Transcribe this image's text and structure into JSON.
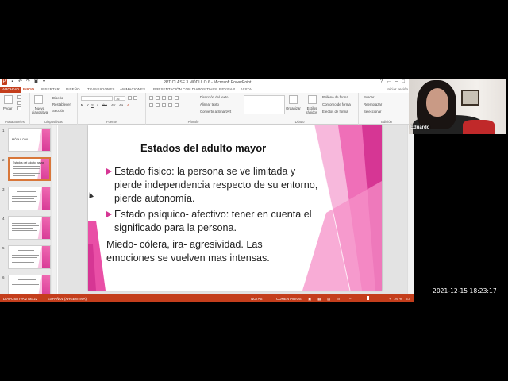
{
  "window": {
    "title": "PPT CLASE 3 MÓDULO 6 - Microsoft PowerPoint",
    "signin": "Iniciar sesión"
  },
  "ribbon_tabs": [
    "INICIO",
    "INSERTAR",
    "DISEÑO",
    "TRANSICIONES",
    "ANIMACIONES",
    "PRESENTACIÓN CON DIAPOSITIVAS",
    "REVISAR",
    "VISTA"
  ],
  "file_tab": "ARCHIVO",
  "ribbon": {
    "portapapeles": {
      "label": "Portapapeles",
      "pegar": "Pegar"
    },
    "diapositivas": {
      "label": "Diapositivas",
      "nueva": "Nueva diapositiva",
      "diseno": "Diseño",
      "restablecer": "Restablecer",
      "seccion": "Sección"
    },
    "fuente": {
      "label": "Fuente",
      "size": "16"
    },
    "parrafo": {
      "label": "Párrafo",
      "direccion": "Dirección del texto",
      "alinear": "Alinear texto",
      "smartart": "Convertir a SmartArt"
    },
    "dibujo": {
      "label": "Dibujo",
      "organizar": "Organizar",
      "estilos": "Estilos rápidos",
      "relleno": "Relleno de forma",
      "contorno": "Contorno de forma",
      "efectos": "Efectos de forma"
    },
    "edicion": {
      "label": "Edición",
      "buscar": "Buscar",
      "reemplazar": "Reemplazar",
      "seleccionar": "Seleccionar"
    }
  },
  "thumbnails": [
    {
      "num": "1",
      "title": "MÓDULO VI"
    },
    {
      "num": "2",
      "title": "Estados del adulto mayor"
    },
    {
      "num": "3",
      "title": ""
    },
    {
      "num": "4",
      "title": ""
    },
    {
      "num": "5",
      "title": ""
    },
    {
      "num": "6",
      "title": ""
    }
  ],
  "slide": {
    "title": "Estados del adulto mayor",
    "bullet1": "Estado físico: la persona se ve limitada y pierde independencia respecto de su entorno, pierde autonomía.",
    "bullet2": "Estado psíquico- afectivo: tener en cuenta el significado para la persona.",
    "paragraph": "Miedo- cólera, ira- agresividad. Las emociones se vuelven mas intensas."
  },
  "status": {
    "slide_info": "DIAPOSITIVA 2 DE 22",
    "language": "ESPAÑOL (ARGENTINA)",
    "notas": "NOTAS",
    "comentarios": "COMENTARIOS",
    "zoom": "76 %"
  },
  "camera": {
    "name": "Eduardo"
  },
  "timestamp": "2021-12-15  18:23:17",
  "colors": {
    "accent": "#c43e1c",
    "pink": "#d63694"
  }
}
